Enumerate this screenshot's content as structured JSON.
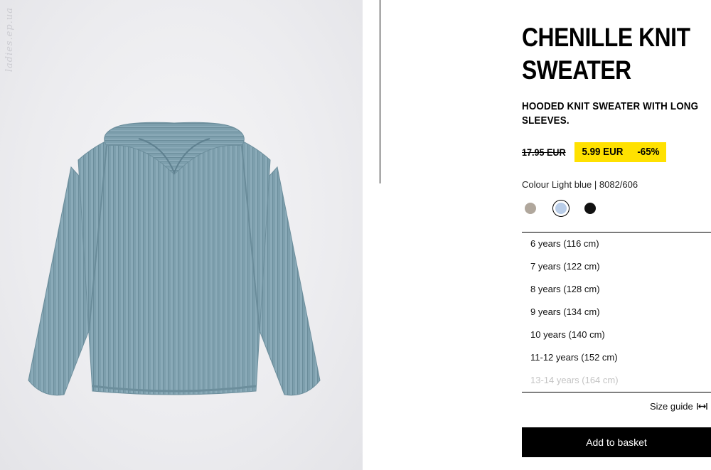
{
  "product": {
    "image_alt": "light blue hooded chenille knit sweater",
    "watermark": "ladies.ep.ua",
    "title_line1": "CHENILLE KNIT",
    "title_line2": "SWEATER",
    "subtitle": "HOODED KNIT SWEATER WITH LONG SLEEVES.",
    "old_price": "17.95 EUR",
    "sale_price": "5.99 EUR",
    "discount": "-65%",
    "colour_label": "Colour Light blue | 8082/606"
  },
  "colours": [
    {
      "name": "beige-grey",
      "hex": "#b0a79c",
      "selected": false
    },
    {
      "name": "light-blue",
      "hex": "#b9cde8",
      "selected": true
    },
    {
      "name": "black",
      "hex": "#111111",
      "selected": false
    }
  ],
  "accent": {
    "sale_highlight": "#ffe100",
    "button_bg": "#000000",
    "disabled_text": "#c4c4c4"
  },
  "sizes": [
    {
      "label": "6 years (116 cm)",
      "available": true
    },
    {
      "label": "7 years (122 cm)",
      "available": true
    },
    {
      "label": "8 years (128 cm)",
      "available": true
    },
    {
      "label": "9 years (134 cm)",
      "available": true
    },
    {
      "label": "10 years (140 cm)",
      "available": true
    },
    {
      "label": "11-12 years (152 cm)",
      "available": true
    },
    {
      "label": "13-14 years (164 cm)",
      "available": false
    }
  ],
  "size_guide": {
    "label": "Size guide",
    "icon": "ruler-arrows-icon"
  },
  "actions": {
    "add_to_basket": "Add to basket"
  }
}
